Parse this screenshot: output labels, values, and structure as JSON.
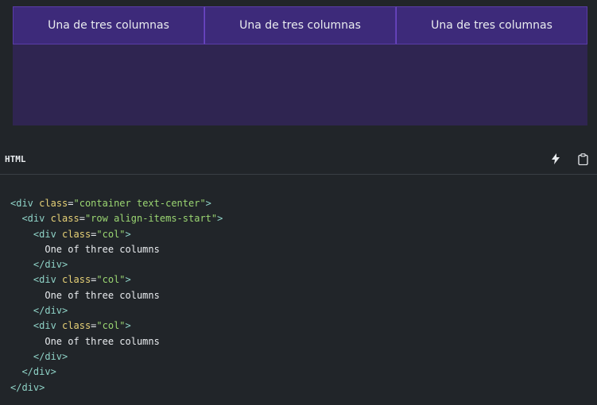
{
  "demo": {
    "columns": [
      "Una de tres columnas",
      "Una de tres columnas",
      "Una de tres columnas"
    ]
  },
  "code_header": {
    "language": "HTML",
    "icons": [
      "lightning-icon",
      "clipboard-icon"
    ]
  },
  "code": {
    "lines": [
      {
        "indent": 0,
        "kind": "open",
        "tag": "div",
        "attr": "class",
        "value": "\"container text-center\""
      },
      {
        "indent": 1,
        "kind": "open",
        "tag": "div",
        "attr": "class",
        "value": "\"row align-items-start\""
      },
      {
        "indent": 2,
        "kind": "open",
        "tag": "div",
        "attr": "class",
        "value": "\"col\""
      },
      {
        "indent": 3,
        "kind": "text",
        "text": "One of three columns"
      },
      {
        "indent": 2,
        "kind": "close",
        "tag": "div"
      },
      {
        "indent": 2,
        "kind": "open",
        "tag": "div",
        "attr": "class",
        "value": "\"col\""
      },
      {
        "indent": 3,
        "kind": "text",
        "text": "One of three columns"
      },
      {
        "indent": 2,
        "kind": "close",
        "tag": "div"
      },
      {
        "indent": 2,
        "kind": "open",
        "tag": "div",
        "attr": "class",
        "value": "\"col\""
      },
      {
        "indent": 3,
        "kind": "text",
        "text": "One of three columns"
      },
      {
        "indent": 2,
        "kind": "close",
        "tag": "div"
      },
      {
        "indent": 1,
        "kind": "close",
        "tag": "div"
      },
      {
        "indent": 0,
        "kind": "close",
        "tag": "div"
      }
    ]
  },
  "colors": {
    "background": "#212529",
    "demo_background": "#2f2551",
    "column_background": "#3d2a7a",
    "tag": "#8fd3c7",
    "attribute": "#e7d177",
    "string": "#9bd672"
  }
}
